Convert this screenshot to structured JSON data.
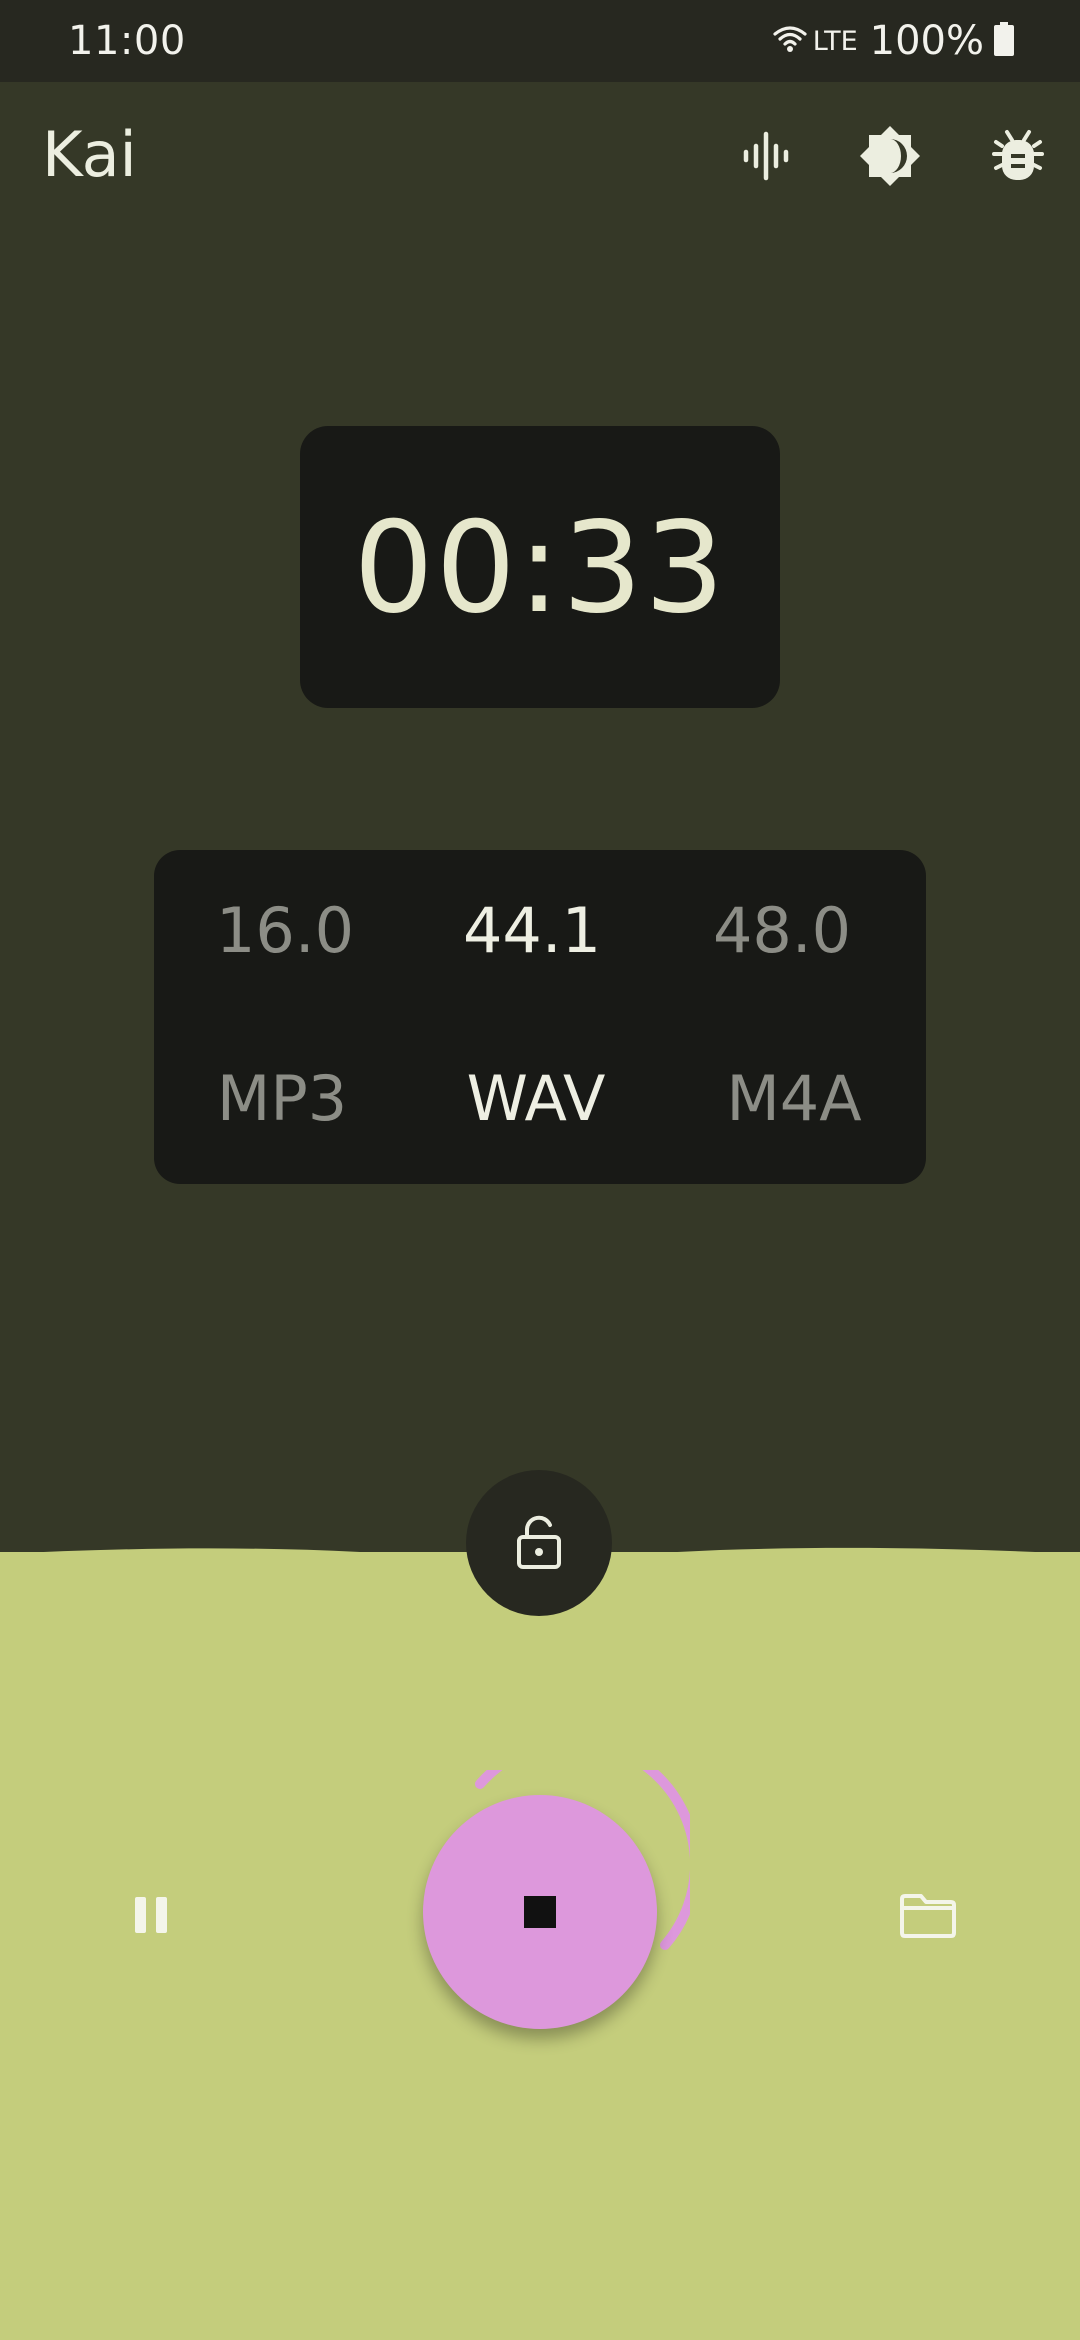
{
  "status_bar": {
    "time": "11:00",
    "network": "LTE",
    "battery": "100%",
    "icons": [
      "wifi-icon",
      "battery-icon"
    ]
  },
  "app_bar": {
    "title": "Kai",
    "actions": [
      "waveform-icon",
      "theme-contrast-icon",
      "bug-icon"
    ]
  },
  "timer": {
    "elapsed": "00:33"
  },
  "sample_rates": {
    "options": [
      "16.0",
      "44.1",
      "48.0"
    ],
    "selected": "44.1"
  },
  "formats": {
    "options": [
      "MP3",
      "WAV",
      "M4A"
    ],
    "selected": "WAV"
  },
  "controls": {
    "lock_icon": "unlock-icon",
    "pause_icon": "pause-icon",
    "stop_icon": "stop-icon",
    "folder_icon": "folder-icon"
  },
  "colors": {
    "background": "#353827",
    "status_bar": "#272820",
    "panel": "#181916",
    "bottom_panel": "#c4cd7c",
    "accent": "#dd98dc",
    "timer_text": "#e6e7cc"
  }
}
